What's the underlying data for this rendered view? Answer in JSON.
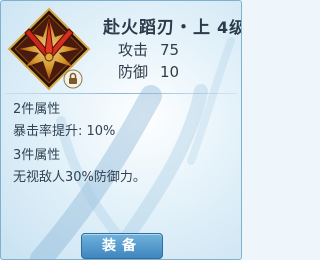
{
  "item": {
    "name": "赴火蹈刃・上",
    "level": "4级",
    "icon": "flaming-sword-emblem-icon",
    "badge_icon": "lock-icon"
  },
  "stats": {
    "attack_label": "攻击",
    "attack_value": "75",
    "defense_label": "防御",
    "defense_value": "10"
  },
  "set_bonus": {
    "two_piece_heading": "2件属性",
    "two_piece_effect": "暴击率提升: 10%",
    "three_piece_heading": "3件属性",
    "three_piece_effect": "无视敌人30%防御力。"
  },
  "actions": {
    "equip_label": "装备"
  },
  "colors": {
    "panel_bg": "#e2f1fa",
    "title_text": "#2c3a4a",
    "button_bg": "#4a90c8",
    "emblem_red": "#c8281a",
    "emblem_gold": "#e0a93a"
  }
}
